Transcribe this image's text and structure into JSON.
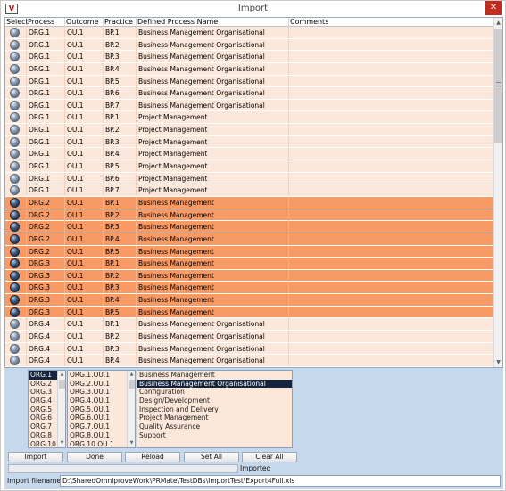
{
  "window": {
    "title": "Import",
    "close_label": "✕",
    "app_icon_label": "V"
  },
  "table": {
    "columns": [
      "Select",
      "Process",
      "Outcome",
      "Practice",
      "Defined Process Name",
      "Comments"
    ],
    "rows": [
      {
        "process": "ORG.1",
        "outcome": "OU.1",
        "practice": "BP.1",
        "name": "Business Management Organisational",
        "comment": "",
        "highlight": false
      },
      {
        "process": "ORG.1",
        "outcome": "OU.1",
        "practice": "BP.2",
        "name": "Business Management Organisational",
        "comment": "",
        "highlight": false
      },
      {
        "process": "ORG.1",
        "outcome": "OU.1",
        "practice": "BP.3",
        "name": "Business Management Organisational",
        "comment": "",
        "highlight": false
      },
      {
        "process": "ORG.1",
        "outcome": "OU.1",
        "practice": "BP.4",
        "name": "Business Management Organisational",
        "comment": "",
        "highlight": false
      },
      {
        "process": "ORG.1",
        "outcome": "OU.1",
        "practice": "BP.5",
        "name": "Business Management Organisational",
        "comment": "",
        "highlight": false
      },
      {
        "process": "ORG.1",
        "outcome": "OU.1",
        "practice": "BP.6",
        "name": "Business Management Organisational",
        "comment": "",
        "highlight": false
      },
      {
        "process": "ORG.1",
        "outcome": "OU.1",
        "practice": "BP.7",
        "name": "Business Management Organisational",
        "comment": "",
        "highlight": false
      },
      {
        "process": "ORG.1",
        "outcome": "OU.1",
        "practice": "BP.1",
        "name": "Project Management",
        "comment": "",
        "highlight": false
      },
      {
        "process": "ORG.1",
        "outcome": "OU.1",
        "practice": "BP.2",
        "name": "Project Management",
        "comment": "",
        "highlight": false
      },
      {
        "process": "ORG.1",
        "outcome": "OU.1",
        "practice": "BP.3",
        "name": "Project Management",
        "comment": "",
        "highlight": false
      },
      {
        "process": "ORG.1",
        "outcome": "OU.1",
        "practice": "BP.4",
        "name": "Project Management",
        "comment": "",
        "highlight": false
      },
      {
        "process": "ORG.1",
        "outcome": "OU.1",
        "practice": "BP.5",
        "name": "Project Management",
        "comment": "",
        "highlight": false
      },
      {
        "process": "ORG.1",
        "outcome": "OU.1",
        "practice": "BP.6",
        "name": "Project Management",
        "comment": "",
        "highlight": false
      },
      {
        "process": "ORG.1",
        "outcome": "OU.1",
        "practice": "BP.7",
        "name": "Project Management",
        "comment": "",
        "highlight": false
      },
      {
        "process": "ORG.2",
        "outcome": "OU.1",
        "practice": "BP.1",
        "name": "Business Management",
        "comment": "",
        "highlight": true
      },
      {
        "process": "ORG.2",
        "outcome": "OU.1",
        "practice": "BP.2",
        "name": "Business Management",
        "comment": "",
        "highlight": true
      },
      {
        "process": "ORG.2",
        "outcome": "OU.1",
        "practice": "BP.3",
        "name": "Business Management",
        "comment": "",
        "highlight": true
      },
      {
        "process": "ORG.2",
        "outcome": "OU.1",
        "practice": "BP.4",
        "name": "Business Management",
        "comment": "",
        "highlight": true
      },
      {
        "process": "ORG.2",
        "outcome": "OU.1",
        "practice": "BP.5",
        "name": "Business Management",
        "comment": "",
        "highlight": true
      },
      {
        "process": "ORG.3",
        "outcome": "OU.1",
        "practice": "BP.1",
        "name": "Business Management",
        "comment": "",
        "highlight": true
      },
      {
        "process": "ORG.3",
        "outcome": "OU.1",
        "practice": "BP.2",
        "name": "Business Management",
        "comment": "",
        "highlight": true
      },
      {
        "process": "ORG.3",
        "outcome": "OU.1",
        "practice": "BP.3",
        "name": "Business Management",
        "comment": "",
        "highlight": true
      },
      {
        "process": "ORG.3",
        "outcome": "OU.1",
        "practice": "BP.4",
        "name": "Business Management",
        "comment": "",
        "highlight": true
      },
      {
        "process": "ORG.3",
        "outcome": "OU.1",
        "practice": "BP.5",
        "name": "Business Management",
        "comment": "",
        "highlight": true
      },
      {
        "process": "ORG.4",
        "outcome": "OU.1",
        "practice": "BP.1",
        "name": "Business Management Organisational",
        "comment": "",
        "highlight": false
      },
      {
        "process": "ORG.4",
        "outcome": "OU.1",
        "practice": "BP.2",
        "name": "Business Management Organisational",
        "comment": "",
        "highlight": false
      },
      {
        "process": "ORG.4",
        "outcome": "OU.1",
        "practice": "BP.3",
        "name": "Business Management Organisational",
        "comment": "",
        "highlight": false
      },
      {
        "process": "ORG.4",
        "outcome": "OU.1",
        "practice": "BP.4",
        "name": "Business Management Organisational",
        "comment": "",
        "highlight": false
      }
    ]
  },
  "lists": {
    "processes": [
      "ORG.1",
      "ORG.2",
      "ORG.3",
      "ORG.4",
      "ORG.5",
      "ORG.6",
      "ORG.7",
      "ORG.8",
      "ORG.10"
    ],
    "processes_selected": "ORG.1",
    "outcomes": [
      "ORG.1.OU.1",
      "ORG.2.OU.1",
      "ORG.3.OU.1",
      "ORG.4.OU.1",
      "ORG.5.OU.1",
      "ORG.6.OU.1",
      "ORG.7.OU.1",
      "ORG.8.OU.1",
      "ORG.10.OU.1"
    ],
    "defined_processes": [
      "Business Management",
      "Business Management Organisational",
      "Configuration",
      "Design/Development",
      "Inspection and Delivery",
      "Project Management",
      "Quality Assurance",
      "Support"
    ],
    "defined_processes_selected": "Business Management Organisational"
  },
  "buttons": {
    "import": "Import",
    "done": "Done",
    "reload": "Reload",
    "set_all": "Set All",
    "clear_all": "Clear All"
  },
  "status": {
    "text": "Imported"
  },
  "file": {
    "label": "Import filename",
    "value": "D:\\SharedOmniproveWork\\PRMate\\TestDBs\\ImportTest\\Export4Full.xls"
  },
  "scroll_glyphs": {
    "up": "▲",
    "down": "▼"
  }
}
